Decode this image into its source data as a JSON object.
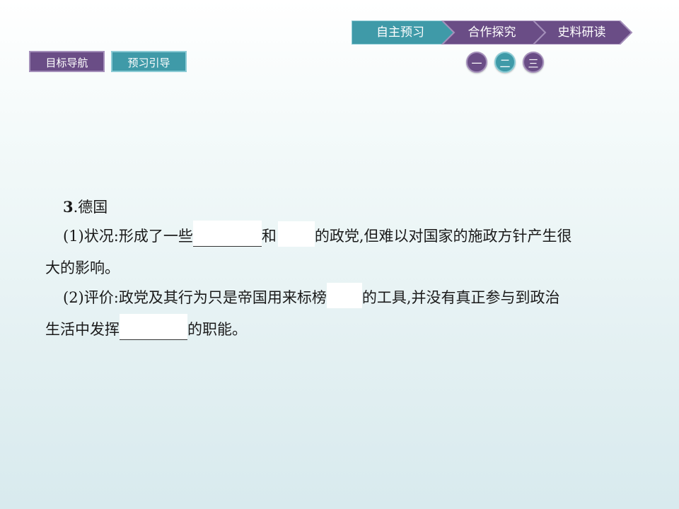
{
  "nav": {
    "steps": [
      "自主预习",
      "合作探究",
      "史料研读"
    ],
    "colors": {
      "teal": "#3f9aa8",
      "purple": "#6a4d86"
    }
  },
  "tabs": [
    "目标导航",
    "预习引导"
  ],
  "sections": [
    "一",
    "二",
    "三"
  ],
  "content": {
    "heading_num": "3",
    "heading_text": ".德国",
    "p1_a": "(1)状况:形成了一些",
    "p1_b": "和",
    "p1_c": "的政党,但难以对国家的施政方针产生很",
    "p1_d": "大的影响。",
    "p2_a": "(2)评价:政党及其行为只是帝国用来标榜",
    "p2_b": "的工具,并没有真正参与到政治",
    "p2_c": "生活中发挥",
    "p2_d": "的职能。"
  }
}
